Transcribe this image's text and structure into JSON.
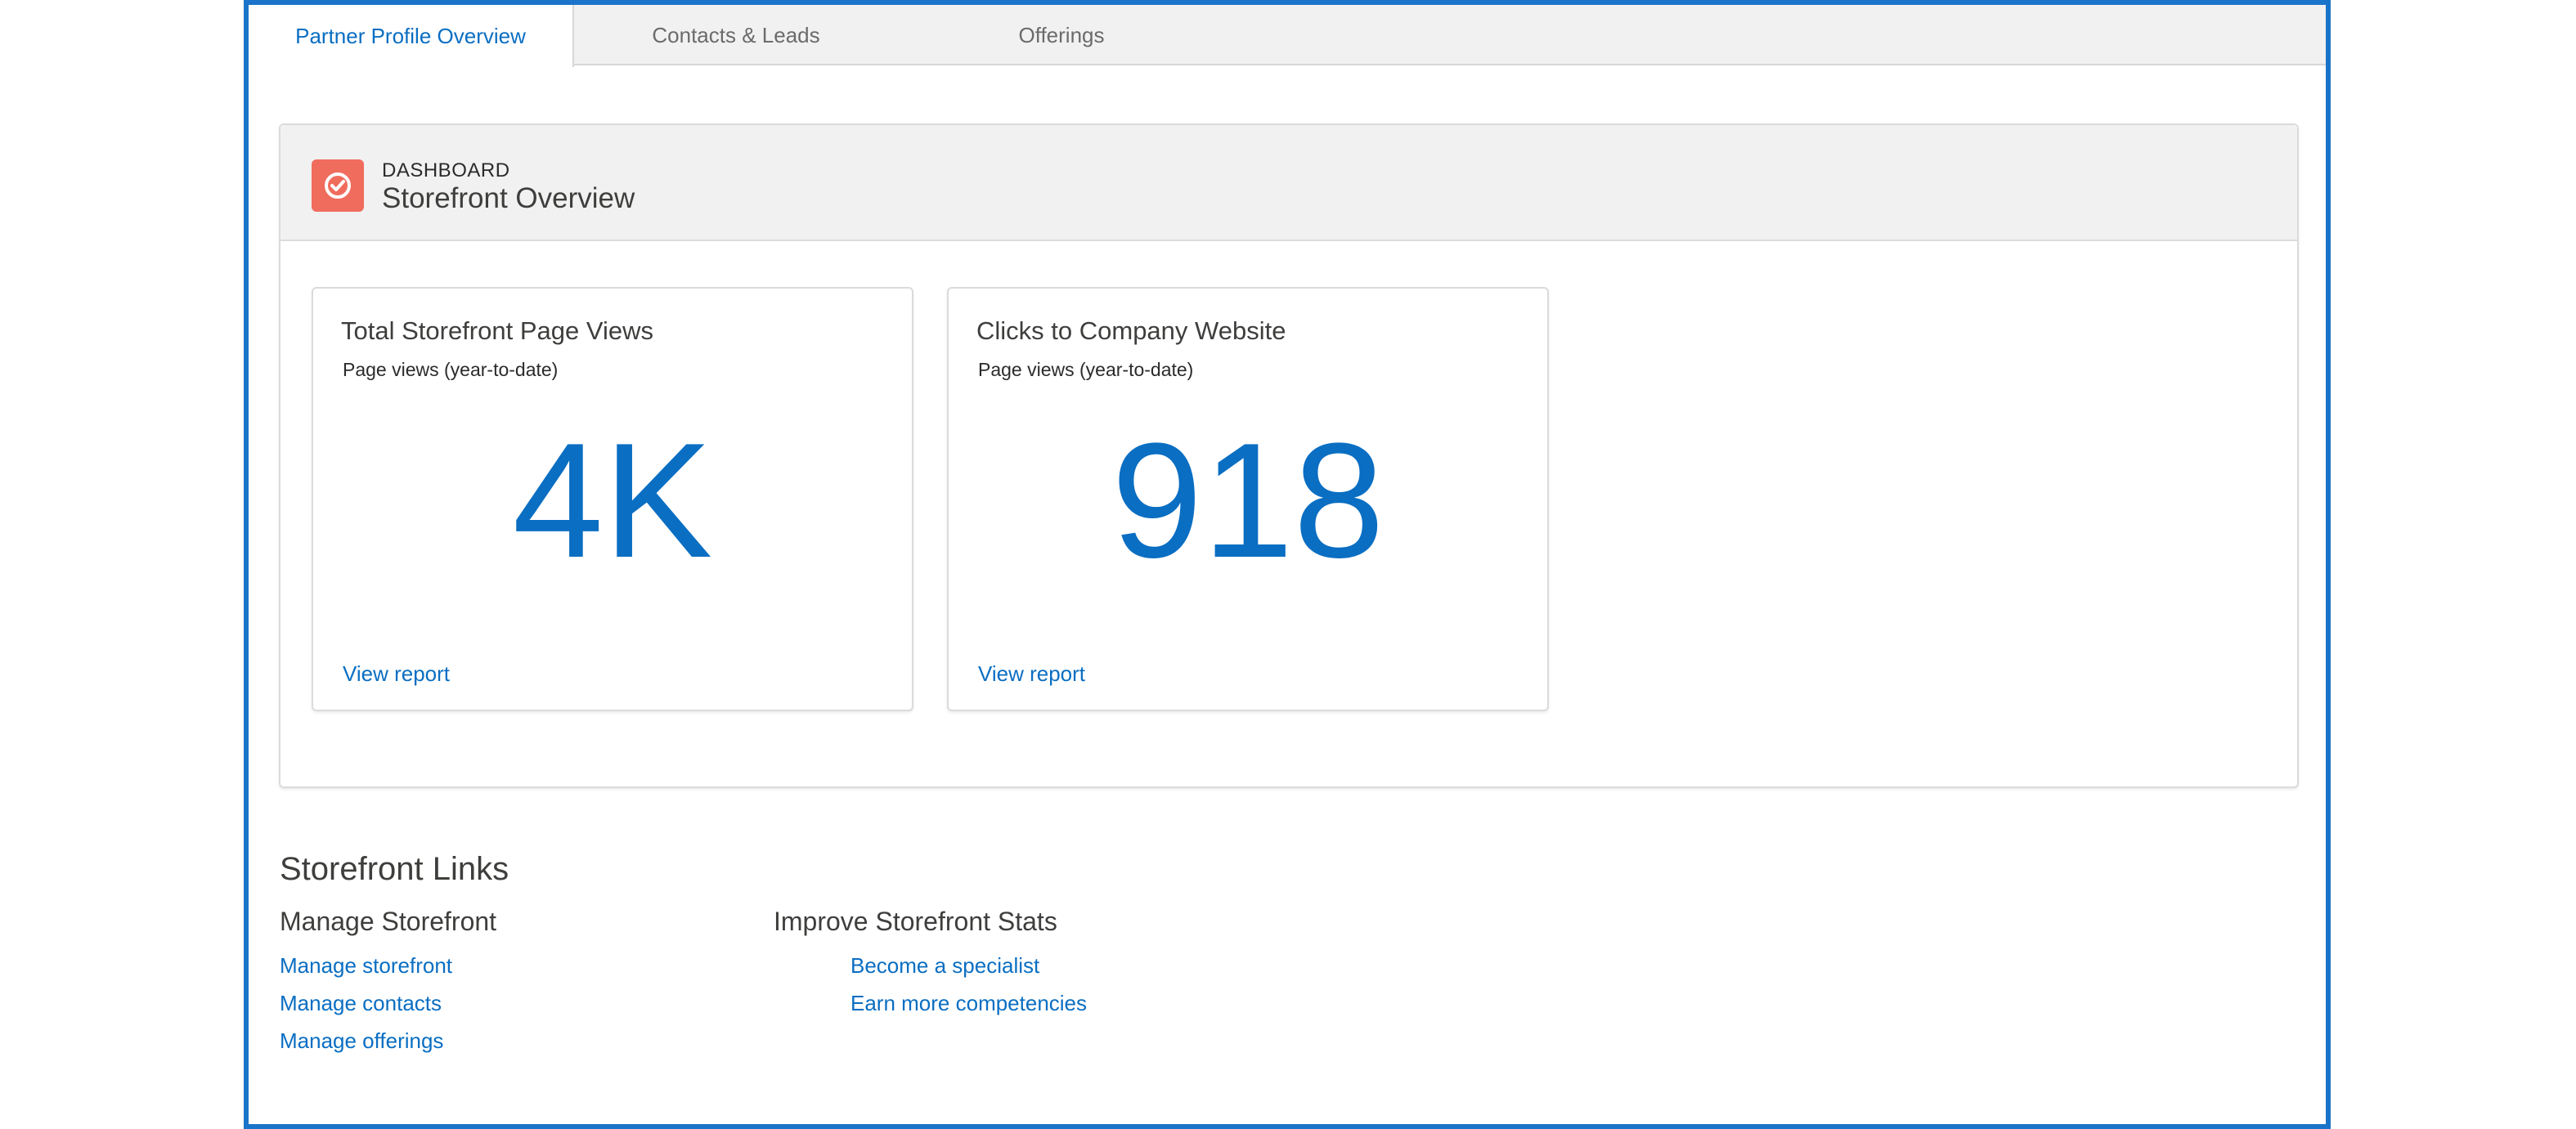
{
  "tabs": [
    {
      "label": "Partner Profile Overview",
      "active": true
    },
    {
      "label": "Contacts & Leads",
      "active": false
    },
    {
      "label": "Offerings",
      "active": false
    }
  ],
  "dashboard": {
    "kicker": "DASHBOARD",
    "title": "Storefront Overview",
    "icon": "gauge-icon",
    "icon_color": "#f06c5d",
    "metrics": [
      {
        "title": "Total Storefront Page Views",
        "subtitle": "Page views (year-to-date)",
        "value": "4K",
        "link": "View report"
      },
      {
        "title": "Clicks to Company Website",
        "subtitle": "Page views (year-to-date)",
        "value": "918",
        "link": "View report"
      }
    ]
  },
  "links": {
    "title": "Storefront Links",
    "manage": {
      "title": "Manage Storefront",
      "items": [
        "Manage storefront",
        "Manage contacts",
        "Manage offerings"
      ]
    },
    "improve": {
      "title": "Improve Storefront Stats",
      "items": [
        "Become a specialist",
        "Earn more competencies"
      ]
    }
  },
  "colors": {
    "accent": "#0a6ec2",
    "frame_border": "#1a74c9"
  }
}
